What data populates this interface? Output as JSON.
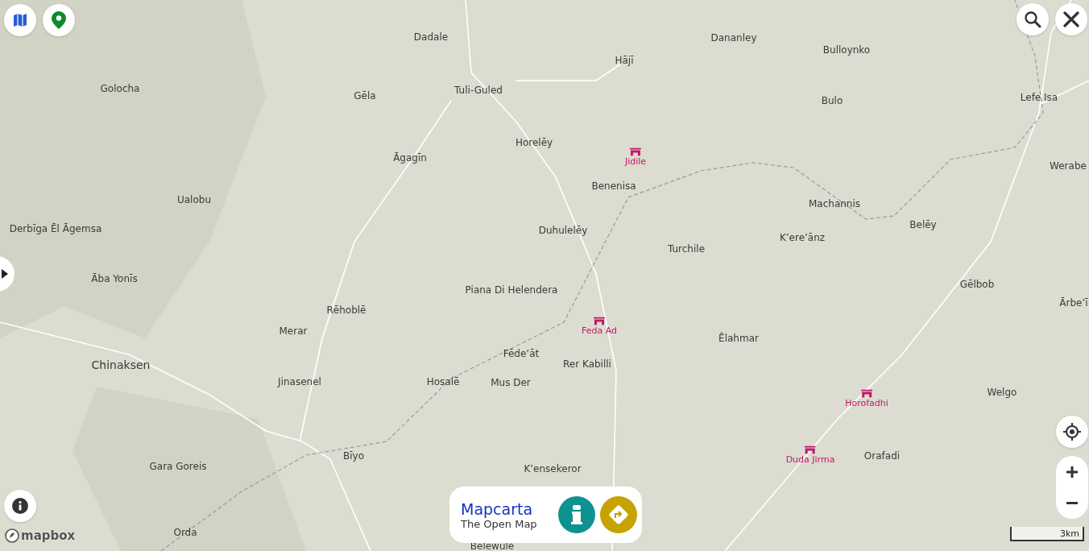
{
  "places": [
    {
      "name": "Dadale",
      "kind": "town"
    },
    {
      "name": "Dananley",
      "kind": "town"
    },
    {
      "name": "Hājī",
      "kind": "town"
    },
    {
      "name": "Bulloynko",
      "kind": "town"
    },
    {
      "name": "Golocha",
      "kind": "town"
    },
    {
      "name": "Gēla",
      "kind": "town"
    },
    {
      "name": "Tuli-Guled",
      "kind": "town"
    },
    {
      "name": "Bulo",
      "kind": "town"
    },
    {
      "name": "Lefe Isa",
      "kind": "town"
    },
    {
      "name": "Horelēy",
      "kind": "town"
    },
    {
      "name": "Āgagīn",
      "kind": "town"
    },
    {
      "name": "Jidile",
      "kind": "poi"
    },
    {
      "name": "Benenisa",
      "kind": "town"
    },
    {
      "name": "Werabe",
      "kind": "town"
    },
    {
      "name": "Ualobu",
      "kind": "town"
    },
    {
      "name": "Machannis",
      "kind": "town"
    },
    {
      "name": "Derbīga Ēl Āgemsa",
      "kind": "town"
    },
    {
      "name": "Belēy",
      "kind": "town"
    },
    {
      "name": "Duhulelēy",
      "kind": "town"
    },
    {
      "name": "K’ere’ānz",
      "kind": "town"
    },
    {
      "name": "Turchile",
      "kind": "town"
    },
    {
      "name": "Āba Yonīs",
      "kind": "town"
    },
    {
      "name": "Gēlbob",
      "kind": "town"
    },
    {
      "name": "Piana Di Helendera",
      "kind": "town"
    },
    {
      "name": "Ārbe’ī",
      "kind": "town"
    },
    {
      "name": "Rēhoblē",
      "kind": "town"
    },
    {
      "name": "Feda Ad",
      "kind": "poi"
    },
    {
      "name": "Merar",
      "kind": "town"
    },
    {
      "name": "Ēlahmar",
      "kind": "town"
    },
    {
      "name": "Fēde’āt",
      "kind": "town"
    },
    {
      "name": "Rer Kabilli",
      "kind": "town"
    },
    {
      "name": "Chinaksen",
      "kind": "city"
    },
    {
      "name": "Jinasenel",
      "kind": "town"
    },
    {
      "name": "Hosalē",
      "kind": "town"
    },
    {
      "name": "Mus Der",
      "kind": "town"
    },
    {
      "name": "Welgo",
      "kind": "town"
    },
    {
      "name": "Horofadhi",
      "kind": "poi"
    },
    {
      "name": "Duda Jirma",
      "kind": "poi"
    },
    {
      "name": "Orafadi",
      "kind": "town"
    },
    {
      "name": "Bīyo",
      "kind": "town"
    },
    {
      "name": "Gara Goreis",
      "kind": "town"
    },
    {
      "name": "K’ensekeror",
      "kind": "town"
    },
    {
      "name": "Orda",
      "kind": "town"
    },
    {
      "name": "Belewule",
      "kind": "town"
    }
  ],
  "attribution": "mapbox",
  "brand": {
    "title": "Mapcarta",
    "subtitle": "The Open Map"
  },
  "scale": "3km"
}
